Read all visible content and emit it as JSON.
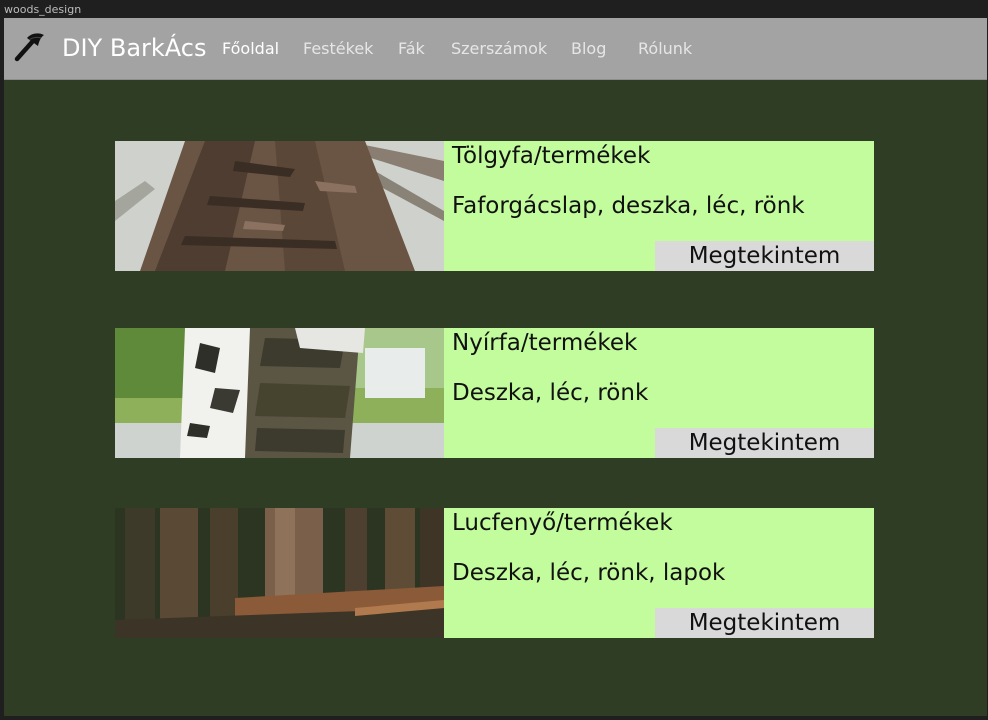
{
  "window": {
    "title": "woods_design"
  },
  "brand": {
    "name": "DIY BarkÁcs",
    "icon": "axe-icon"
  },
  "nav": [
    {
      "label": "Főoldal",
      "active": true
    },
    {
      "label": "Festékek"
    },
    {
      "label": "Fák"
    },
    {
      "label": "Szerszámok"
    },
    {
      "label": "Blog"
    },
    {
      "label": "Rólunk"
    }
  ],
  "cards": [
    {
      "title": "Tölgyfa/termékek",
      "description": "Faforgácslap, deszka, léc, rönk",
      "button": "Megtekintem",
      "image": "oak-bark-photo"
    },
    {
      "title": "Nyírfa/termékek",
      "description": "Deszka, léc, rönk",
      "button": "Megtekintem",
      "image": "birch-trunk-photo"
    },
    {
      "title": "Lucfenyő/termékek",
      "description": "Deszka, léc, rönk, lapok",
      "button": "Megtekintem",
      "image": "spruce-forest-photo"
    }
  ],
  "colors": {
    "background": "#2f3d24",
    "navbar": "#a3a3a3",
    "card": "#c3fc9c",
    "button": "#d9d9d9"
  }
}
